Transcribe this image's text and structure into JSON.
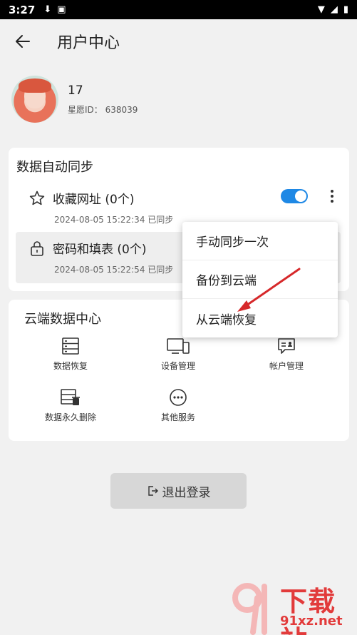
{
  "status_bar": {
    "time": "3:27"
  },
  "header": {
    "title": "用户中心"
  },
  "profile": {
    "name": "17",
    "id_text": "星愿ID：  638039"
  },
  "sync": {
    "title": "数据自动同步",
    "items": [
      {
        "label": "收藏网址 (0个)",
        "time": "2024-08-05 15:22:34 已同步",
        "icon": "star-icon",
        "enabled": true
      },
      {
        "label": "密码和填表 (0个)",
        "time": "2024-08-05 15:22:54 已同步",
        "icon": "lock-icon"
      }
    ]
  },
  "popup_menu": {
    "items": [
      "手动同步一次",
      "备份到云端",
      "从云端恢复"
    ]
  },
  "cloud": {
    "title": "云端数据中心",
    "items": [
      {
        "label": "数据恢复",
        "icon": "server-icon"
      },
      {
        "label": "设备管理",
        "icon": "devices-icon"
      },
      {
        "label": "帐户管理",
        "icon": "account-icon"
      },
      {
        "label": "数据永久删除",
        "icon": "delete-data-icon"
      },
      {
        "label": "其他服务",
        "icon": "more-services-icon"
      }
    ]
  },
  "logout": {
    "label": "退出登录"
  },
  "watermark": {
    "text": "下载站",
    "url": "91xz.net"
  },
  "colors": {
    "accent": "#1e88e5",
    "arrow": "#d6282a",
    "watermark": "#e23b3b"
  }
}
